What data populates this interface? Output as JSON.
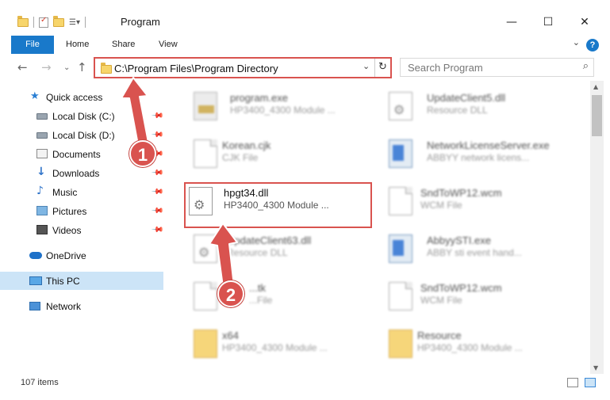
{
  "window": {
    "title": "Program",
    "minimize_icon": "—",
    "maximize_icon": "☐",
    "close_icon": "✕"
  },
  "ribbon": {
    "tabs": [
      "File",
      "Home",
      "Share",
      "View"
    ],
    "help_label": "?"
  },
  "address": {
    "path": "C:\\Program Files\\Program Directory",
    "search_placeholder": "Search Program"
  },
  "sidebar": {
    "items": [
      {
        "label": "Quick access",
        "icon": "star-icon"
      },
      {
        "label": "Local Disk (C:)",
        "icon": "drive-icon",
        "pinned": true
      },
      {
        "label": "Local Disk (D:)",
        "icon": "drive-icon",
        "pinned": true
      },
      {
        "label": "Documents",
        "icon": "documents-icon",
        "pinned": true
      },
      {
        "label": "Downloads",
        "icon": "downloads-icon",
        "pinned": true
      },
      {
        "label": "Music",
        "icon": "music-icon",
        "pinned": true
      },
      {
        "label": "Pictures",
        "icon": "pictures-icon",
        "pinned": true
      },
      {
        "label": "Videos",
        "icon": "videos-icon",
        "pinned": true
      },
      {
        "label": "OneDrive",
        "icon": "onedrive-icon"
      },
      {
        "label": "This PC",
        "icon": "this-pc-icon",
        "selected": true
      },
      {
        "label": "Network",
        "icon": "network-icon"
      }
    ]
  },
  "files": [
    {
      "name": "program.exe",
      "desc": "HP3400_4300 Module ...",
      "icon": "exe-icon"
    },
    {
      "name": "UpdateClient5.dll",
      "desc": "Resource DLL",
      "icon": "gear-page-icon"
    },
    {
      "name": "Korean.cjk",
      "desc": "CJK File",
      "icon": "page-icon"
    },
    {
      "name": "NetworkLicenseServer.exe",
      "desc": "ABBYY network licens...",
      "icon": "app-icon"
    },
    {
      "name": "hpgt34.dll",
      "desc": "HP3400_4300 Module ...",
      "icon": "gear-page-icon",
      "highlighted": true
    },
    {
      "name": "SndToWP12.wcm",
      "desc": "WCM File",
      "icon": "page-icon"
    },
    {
      "name": "UpdateClient63.dll",
      "desc": "Resource DLL",
      "icon": "gear-page-icon"
    },
    {
      "name": "AbbyySTI.exe",
      "desc": "ABBY sti event hand...",
      "icon": "app-icon"
    },
    {
      "name": "...tk",
      "desc": "...File",
      "icon": "page-icon"
    },
    {
      "name": "SndToWP12.wcm",
      "desc": "WCM File",
      "icon": "page-icon"
    },
    {
      "name": "x64",
      "desc": "HP3400_4300 Module ...",
      "icon": "folder-icon"
    },
    {
      "name": "Resource",
      "desc": "HP3400_4300 Module ...",
      "icon": "folder-icon"
    }
  ],
  "status": {
    "item_count": "107 items"
  },
  "callouts": [
    "1",
    "2"
  ],
  "colors": {
    "accent": "#1979ca",
    "highlight_border": "#d9534f",
    "selected_bg": "#cce4f7"
  }
}
